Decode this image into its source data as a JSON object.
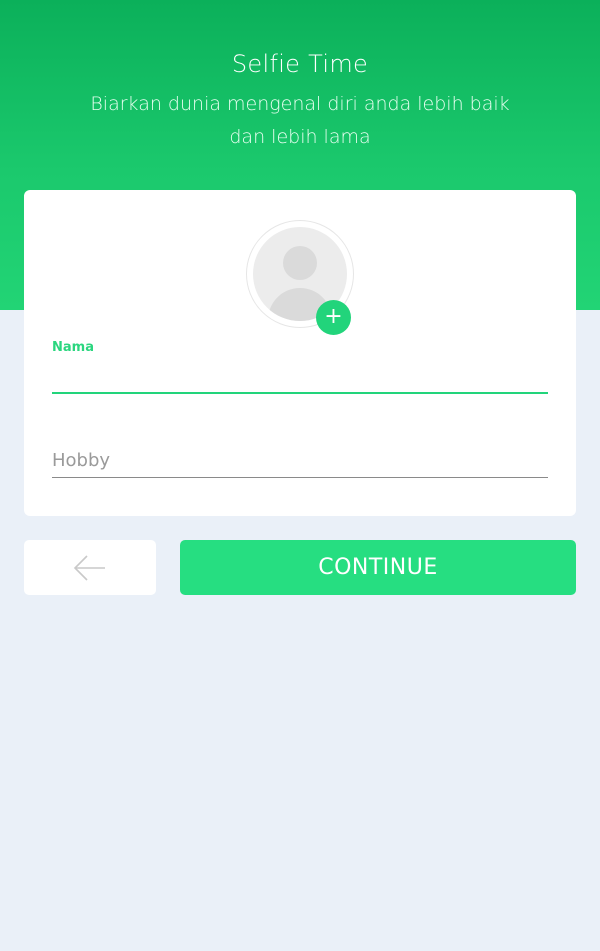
{
  "header": {
    "title": "Selfie Time",
    "subtitle_line1": "Biarkan dunia mengenal diri anda lebih baik",
    "subtitle_line2": "dan lebih lama"
  },
  "profile": {
    "avatar_icon": "user-placeholder-icon",
    "add_photo_symbol": "+"
  },
  "form": {
    "name_label": "Nama",
    "name_value": "",
    "hobby_placeholder": "Hobby",
    "hobby_value": ""
  },
  "actions": {
    "back_icon": "arrow-left-icon",
    "continue_label": "CONTINUE"
  },
  "colors": {
    "accent": "#26de81",
    "header_top": "#0bb05a",
    "background": "#eaf0f8"
  }
}
